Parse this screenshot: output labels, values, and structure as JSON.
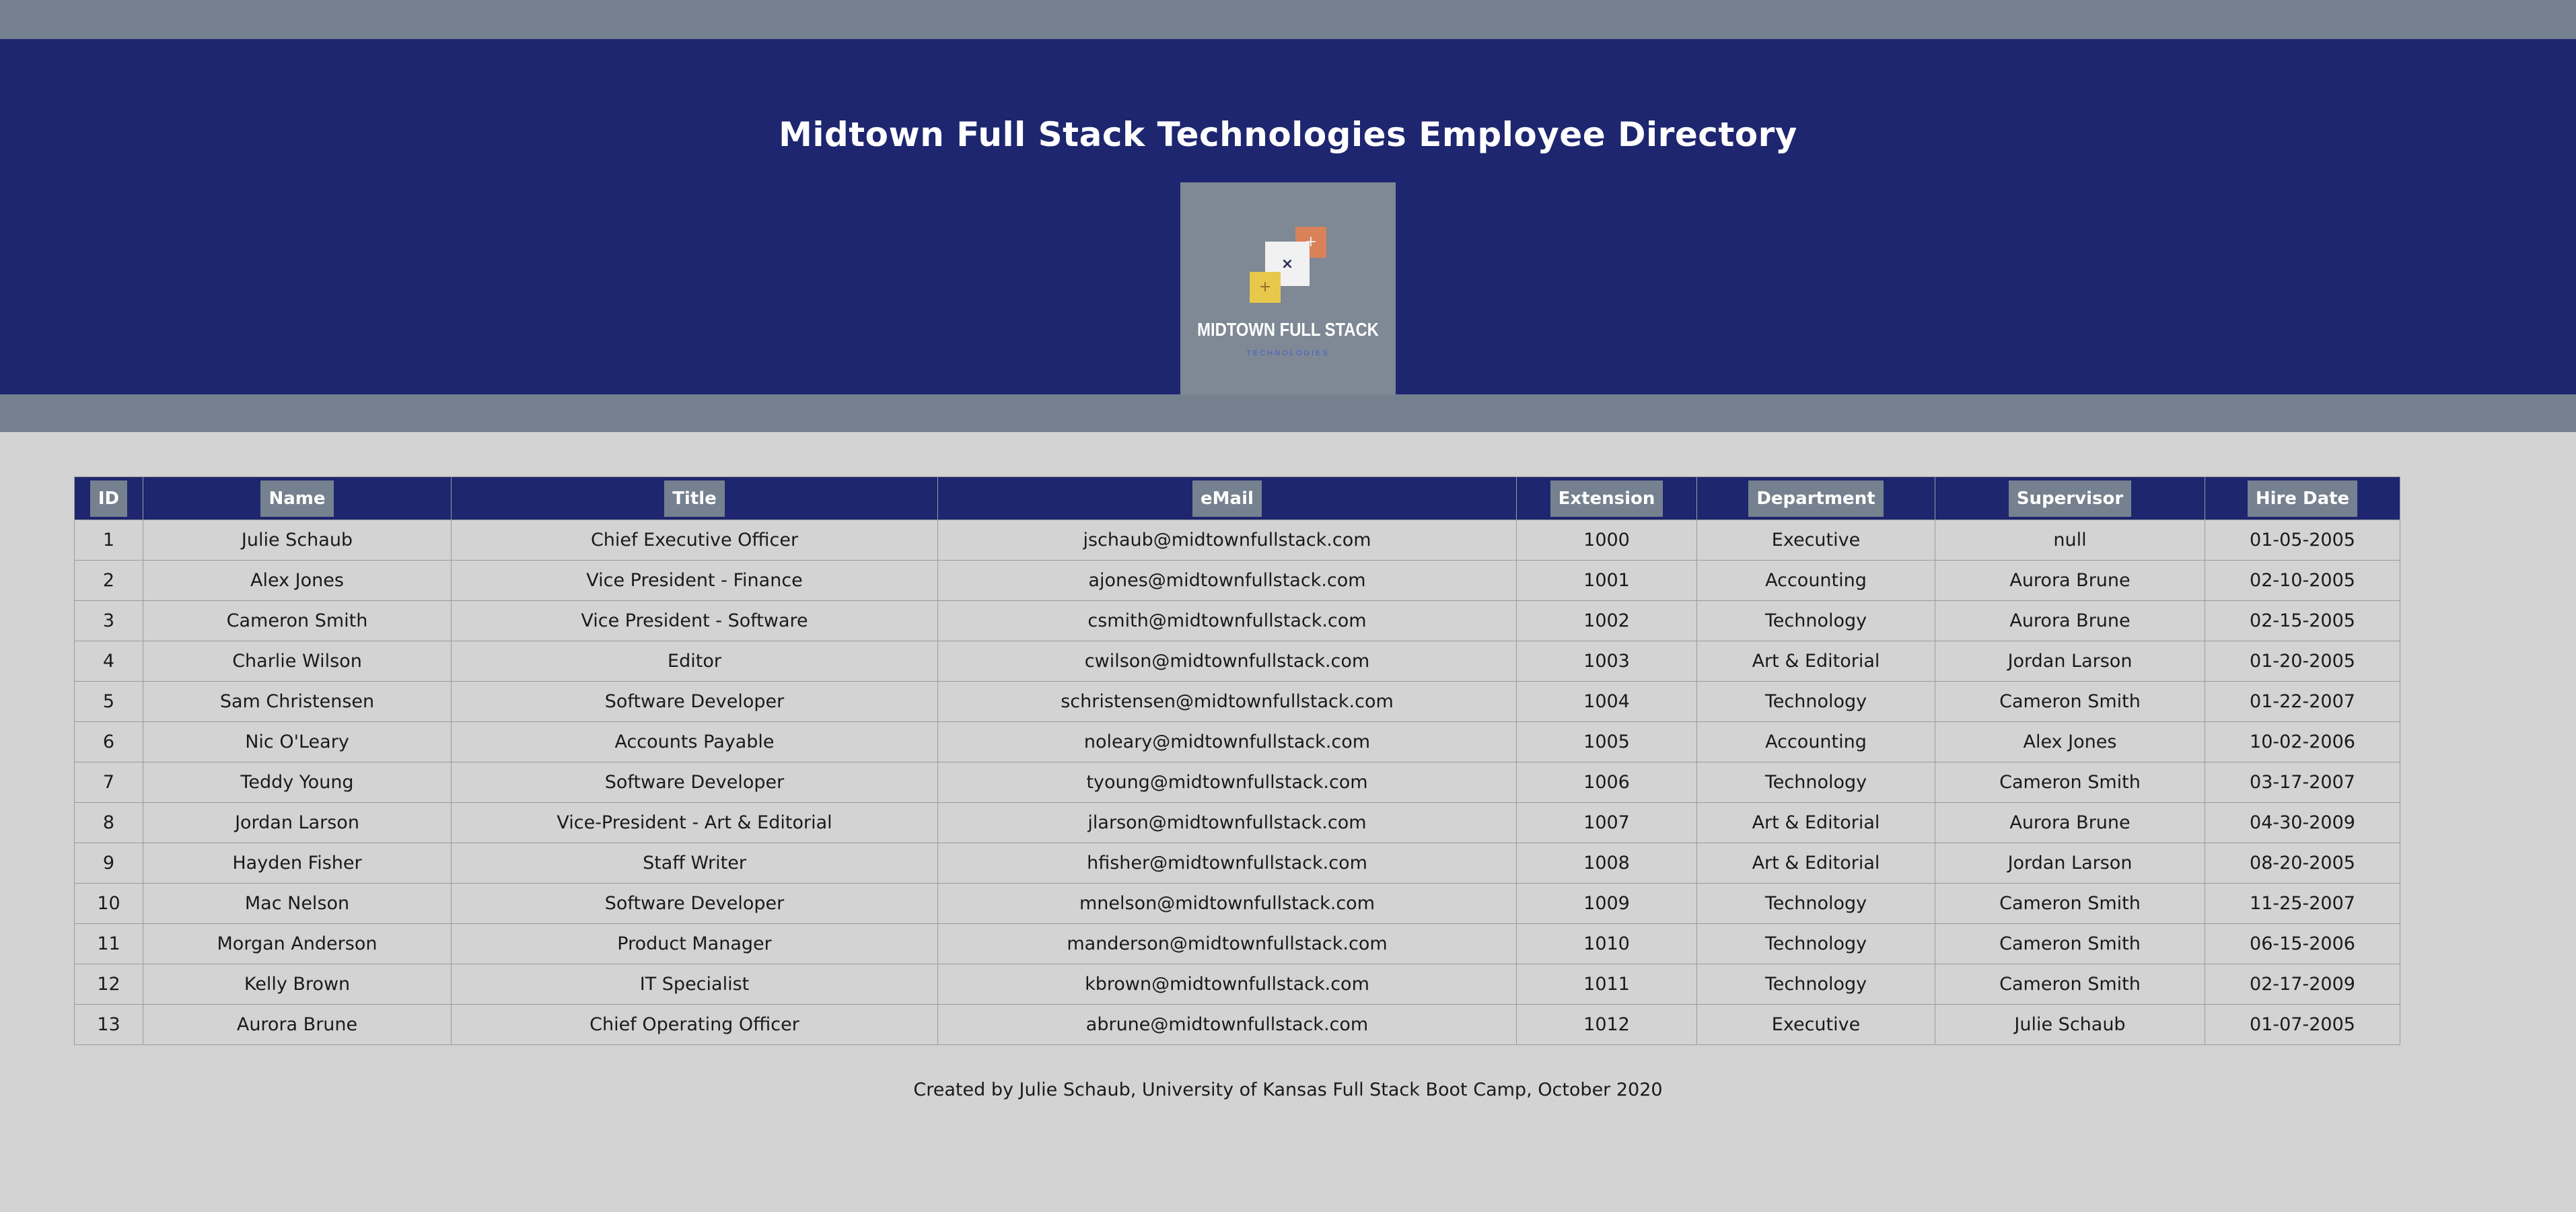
{
  "header": {
    "title": "Midtown Full Stack Technologies Employee Directory",
    "logo_title": "MIDTOWN FULL STACK",
    "logo_subtitle": "TECHNOLOGIES"
  },
  "colors": {
    "banner": "#1e2670",
    "strip": "#75818f",
    "page_bg": "#d3d3d3",
    "logo_bg": "#7e8995",
    "logo_orange": "#d9825a",
    "logo_white": "#f1f1f1",
    "logo_yellow": "#e7c84a"
  },
  "table": {
    "columns": [
      "ID",
      "Name",
      "Title",
      "eMail",
      "Extension",
      "Department",
      "Supervisor",
      "Hire Date"
    ],
    "rows": [
      [
        "1",
        "Julie Schaub",
        "Chief Executive Officer",
        "jschaub@midtownfullstack.com",
        "1000",
        "Executive",
        "null",
        "01-05-2005"
      ],
      [
        "2",
        "Alex Jones",
        "Vice President - Finance",
        "ajones@midtownfullstack.com",
        "1001",
        "Accounting",
        "Aurora Brune",
        "02-10-2005"
      ],
      [
        "3",
        "Cameron Smith",
        "Vice President - Software",
        "csmith@midtownfullstack.com",
        "1002",
        "Technology",
        "Aurora Brune",
        "02-15-2005"
      ],
      [
        "4",
        "Charlie Wilson",
        "Editor",
        "cwilson@midtownfullstack.com",
        "1003",
        "Art & Editorial",
        "Jordan Larson",
        "01-20-2005"
      ],
      [
        "5",
        "Sam Christensen",
        "Software Developer",
        "schristensen@midtownfullstack.com",
        "1004",
        "Technology",
        "Cameron Smith",
        "01-22-2007"
      ],
      [
        "6",
        "Nic O'Leary",
        "Accounts Payable",
        "noleary@midtownfullstack.com",
        "1005",
        "Accounting",
        "Alex Jones",
        "10-02-2006"
      ],
      [
        "7",
        "Teddy Young",
        "Software Developer",
        "tyoung@midtownfullstack.com",
        "1006",
        "Technology",
        "Cameron Smith",
        "03-17-2007"
      ],
      [
        "8",
        "Jordan Larson",
        "Vice-President - Art & Editorial",
        "jlarson@midtownfullstack.com",
        "1007",
        "Art & Editorial",
        "Aurora Brune",
        "04-30-2009"
      ],
      [
        "9",
        "Hayden Fisher",
        "Staff Writer",
        "hfisher@midtownfullstack.com",
        "1008",
        "Art & Editorial",
        "Jordan Larson",
        "08-20-2005"
      ],
      [
        "10",
        "Mac Nelson",
        "Software Developer",
        "mnelson@midtownfullstack.com",
        "1009",
        "Technology",
        "Cameron Smith",
        "11-25-2007"
      ],
      [
        "11",
        "Morgan Anderson",
        "Product Manager",
        "manderson@midtownfullstack.com",
        "1010",
        "Technology",
        "Cameron Smith",
        "06-15-2006"
      ],
      [
        "12",
        "Kelly Brown",
        "IT Specialist",
        "kbrown@midtownfullstack.com",
        "1011",
        "Technology",
        "Cameron Smith",
        "02-17-2009"
      ],
      [
        "13",
        "Aurora Brune",
        "Chief Operating Officer",
        "abrune@midtownfullstack.com",
        "1012",
        "Executive",
        "Julie Schaub",
        "01-07-2005"
      ]
    ]
  },
  "footer": {
    "text": "Created by Julie Schaub, University of Kansas Full Stack Boot Camp, October 2020"
  }
}
